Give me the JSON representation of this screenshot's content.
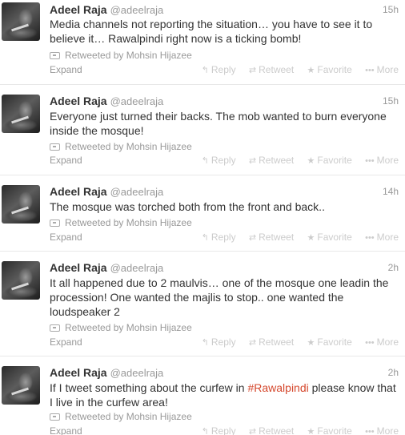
{
  "tweets": [
    {
      "fullname": "Adeel Raja",
      "username": "@adeelraja",
      "time": "15h",
      "text_parts": [
        "Media channels not reporting the situation… you have to see it to believe it… Rawalpindi right now is a ticking bomb!"
      ],
      "retweeted_by": "Retweeted by Mohsin Hijazee",
      "expand": "Expand"
    },
    {
      "fullname": "Adeel Raja",
      "username": "@adeelraja",
      "time": "15h",
      "text_parts": [
        "Everyone just turned their backs. The mob wanted to burn everyone inside the mosque!"
      ],
      "retweeted_by": "Retweeted by Mohsin Hijazee",
      "expand": "Expand"
    },
    {
      "fullname": "Adeel Raja",
      "username": "@adeelraja",
      "time": "14h",
      "text_parts": [
        "The mosque was torched both from the front and back.."
      ],
      "retweeted_by": "Retweeted by Mohsin Hijazee",
      "expand": "Expand"
    },
    {
      "fullname": "Adeel Raja",
      "username": "@adeelraja",
      "time": "2h",
      "text_parts": [
        "It all happened due to 2 maulvis… one of the mosque one leadin the procession! One wanted the majlis to stop.. one wanted the loudspeaker 2"
      ],
      "retweeted_by": "Retweeted by Mohsin Hijazee",
      "expand": "Expand"
    },
    {
      "fullname": "Adeel Raja",
      "username": "@adeelraja",
      "time": "2h",
      "text_parts": [
        "If I tweet something about the curfew in ",
        "#Rawalpindi",
        " please know that I live in the curfew area!"
      ],
      "retweeted_by": "Retweeted by Mohsin Hijazee",
      "expand": "Expand"
    }
  ],
  "actions": {
    "reply": "Reply",
    "retweet": "Retweet",
    "favorite": "Favorite",
    "more": "More"
  },
  "icons": {
    "avatar": "avatar-photo",
    "retweeted": "retweet-icon",
    "reply": "reply-icon",
    "retweet": "retweet-icon",
    "favorite": "star-icon",
    "more": "ellipsis-icon"
  },
  "colors": {
    "name": "#333333",
    "muted": "#999999",
    "action": "#cccccc",
    "hashtag": "#d5482d",
    "divider": "#e8e8e8"
  }
}
